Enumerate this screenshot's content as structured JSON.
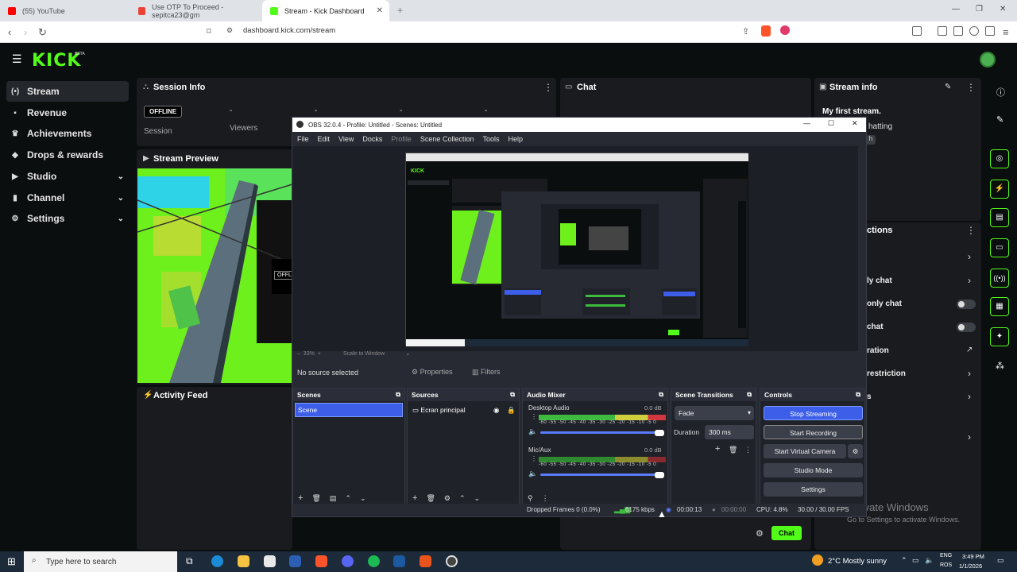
{
  "browser": {
    "tabs": [
      {
        "label": "(55) YouTube",
        "color": "#ff0000"
      },
      {
        "label": "Use OTP To Proceed - sepitca23@gm",
        "color": "#ea4335"
      },
      {
        "label": "Stream - Kick Dashboard",
        "color": "#53fc18"
      }
    ],
    "url": "dashboard.kick.com/stream"
  },
  "kick": {
    "logo": "KICK",
    "beta": "BETA",
    "sidebar": [
      {
        "label": "Stream",
        "icon": "(•)"
      },
      {
        "label": "Revenue",
        "icon": "▪"
      },
      {
        "label": "Achievements",
        "icon": "♛"
      },
      {
        "label": "Drops & rewards",
        "icon": "◆"
      },
      {
        "label": "Studio",
        "icon": "▶"
      },
      {
        "label": "Channel",
        "icon": "▮"
      },
      {
        "label": "Settings",
        "icon": "⚙"
      }
    ],
    "session": {
      "title": "Session Info",
      "status": "OFFLINE",
      "session_label": "Session",
      "viewers_label": "Viewers",
      "dashes": [
        "-",
        "-",
        "-",
        "-"
      ]
    },
    "preview": {
      "title": "Stream Preview",
      "offline": "OFFLI"
    },
    "activity": {
      "title": "Activity Feed"
    },
    "chat": {
      "title": "Chat",
      "button": "Chat"
    },
    "stream_info": {
      "title": "Stream info",
      "stream_title": "My first stream.",
      "partial": "hatting",
      "partial2": "h"
    },
    "actions": {
      "title": "ctions",
      "rows": [
        {
          "label": ""
        },
        {
          "label": "ly chat"
        },
        {
          "label": "only chat"
        },
        {
          "label": "chat"
        },
        {
          "label": "ration"
        },
        {
          "label": "restriction"
        },
        {
          "label": "s"
        }
      ]
    },
    "watermark": {
      "line1": "Activate Windows",
      "line2": "Go to Settings to activate Windows."
    }
  },
  "obs": {
    "title": "OBS 32.0.4 - Profile: Untitled - Scenes: Untitled",
    "menu": [
      "File",
      "Edit",
      "View",
      "Docks",
      "Profile",
      "Scene Collection",
      "Tools",
      "Help"
    ],
    "zoom": "33%",
    "scale": "Scale to Window",
    "no_source": "No source selected",
    "properties": "Properties",
    "filters": "Filters",
    "scenes": {
      "title": "Scenes",
      "items": [
        "Scene"
      ]
    },
    "sources": {
      "title": "Sources",
      "items": [
        "Ecran principal"
      ]
    },
    "mixer": {
      "title": "Audio Mixer",
      "channels": [
        {
          "name": "Desktop Audio",
          "db": "0.0 dB",
          "level": 0.9
        },
        {
          "name": "Mic/Aux",
          "db": "0.0 dB",
          "level": 0.85
        }
      ],
      "scale": "-60 -55 -50 -45 -40 -35 -30 -25 -20 -15 -10 -5 0"
    },
    "transitions": {
      "title": "Scene Transitions",
      "type": "Fade",
      "duration_label": "Duration",
      "duration": "300 ms"
    },
    "controls": {
      "title": "Controls",
      "buttons": [
        "Stop Streaming",
        "Start Recording",
        "Start Virtual Camera",
        "Studio Mode",
        "Settings"
      ]
    },
    "status": {
      "dropped": "Dropped Frames 0 (0.0%)",
      "bitrate": "6175 kbps",
      "live_time": "00:00:13",
      "rec_time": "00:00:00",
      "cpu": "CPU: 4.8%",
      "fps": "30.00 / 30.00 FPS"
    }
  },
  "taskbar": {
    "search_placeholder": "Type here to search",
    "weather": "2°C  Mostly sunny",
    "lang1": "ENG",
    "lang2": "ROS",
    "time": "3:49 PM",
    "date": "1/1/2026"
  }
}
